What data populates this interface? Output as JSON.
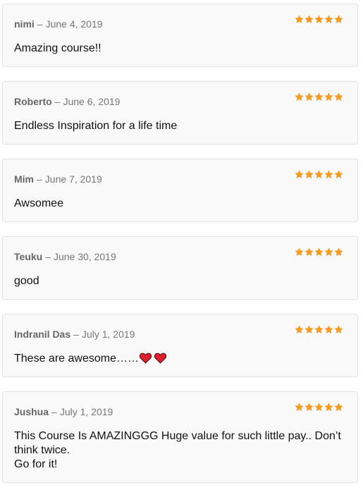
{
  "colors": {
    "star": "#f79b1f",
    "heart": "#e0202e",
    "card_bg": "#f9f9f9",
    "card_border": "#e2e2e2"
  },
  "reviews": [
    {
      "author": "nimi",
      "separator": "–",
      "date": "June 4, 2019",
      "rating": 5,
      "text": "Amazing course!!"
    },
    {
      "author": "Roberto",
      "separator": "–",
      "date": "June 6, 2019",
      "rating": 5,
      "text": "Endless Inspiration for a life time"
    },
    {
      "author": "Mim",
      "separator": "–",
      "date": "June 7, 2019",
      "rating": 5,
      "text": "Awsomee"
    },
    {
      "author": "Teuku",
      "separator": "–",
      "date": "June 30, 2019",
      "rating": 5,
      "text": "good"
    },
    {
      "author": "Indranil Das",
      "separator": "–",
      "date": "July 1, 2019",
      "rating": 5,
      "text": "These are awesome……",
      "emoji": [
        "heart-icon",
        "heart-icon"
      ]
    },
    {
      "author": "Jushua",
      "separator": "–",
      "date": "July 1, 2019",
      "rating": 5,
      "text": "This Course Is AMAZINGGG Huge value for such little pay.. Don’t think twice.\nGo for it!"
    }
  ]
}
